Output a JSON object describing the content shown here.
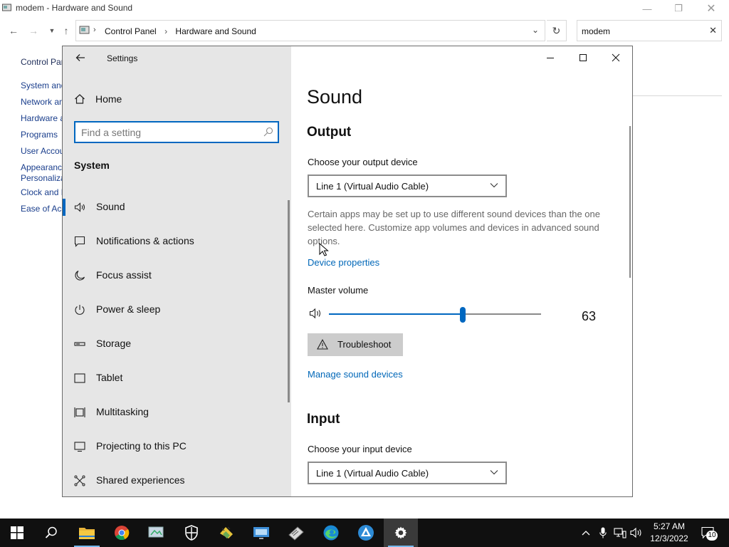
{
  "control_panel": {
    "window_title": "modem - Hardware and Sound",
    "breadcrumb": [
      "Control Panel",
      "Hardware and Sound"
    ],
    "search_value": "modem",
    "side_links": [
      {
        "label": "Control Panel Home"
      },
      {
        "label": "System and Security"
      },
      {
        "label": "Network and Internet"
      },
      {
        "label": "Hardware and Sound"
      },
      {
        "label": "Programs"
      },
      {
        "label": "User Accounts"
      },
      {
        "label": "Appearance and"
      },
      {
        "label": "Personalization"
      },
      {
        "label": "Clock and Region"
      },
      {
        "label": "Ease of Access"
      }
    ]
  },
  "settings": {
    "window_title": "Settings",
    "home_label": "Home",
    "search_placeholder": "Find a setting",
    "category": "System",
    "nav_items": [
      {
        "label": "Sound",
        "icon": "speaker-icon",
        "active": true
      },
      {
        "label": "Notifications & actions",
        "icon": "notification-icon"
      },
      {
        "label": "Focus assist",
        "icon": "moon-icon"
      },
      {
        "label": "Power & sleep",
        "icon": "power-icon"
      },
      {
        "label": "Storage",
        "icon": "storage-icon"
      },
      {
        "label": "Tablet",
        "icon": "tablet-icon"
      },
      {
        "label": "Multitasking",
        "icon": "multitasking-icon"
      },
      {
        "label": "Projecting to this PC",
        "icon": "projecting-icon"
      },
      {
        "label": "Shared experiences",
        "icon": "shared-icon"
      }
    ],
    "page": {
      "title": "Sound",
      "output": {
        "heading": "Output",
        "choose_label": "Choose your output device",
        "selected_device": "Line 1 (Virtual Audio Cable)",
        "description": "Certain apps may be set up to use different sound devices than the one selected here. Customize app volumes and devices in advanced sound options.",
        "device_properties_link": "Device properties",
        "master_volume_label": "Master volume",
        "volume": 63,
        "troubleshoot_label": "Troubleshoot",
        "manage_link": "Manage sound devices"
      },
      "input": {
        "heading": "Input",
        "choose_label": "Choose your input device",
        "selected_device": "Line 1 (Virtual Audio Cable)"
      }
    }
  },
  "taskbar": {
    "apps": [
      "start-button",
      "search-button",
      "file-explorer",
      "chrome",
      "control-panel-app",
      "security-app",
      "network-app",
      "remote-desktop-app",
      "notepad-app",
      "edge",
      "vlc-like-app",
      "settings-app"
    ],
    "time": "5:27 AM",
    "date": "12/3/2022",
    "notification_count": "10"
  },
  "colors": {
    "accent": "#0067c0",
    "link": "#0067b8",
    "nav_bg": "#e6e6e6",
    "taskbar_bg": "#101010"
  }
}
